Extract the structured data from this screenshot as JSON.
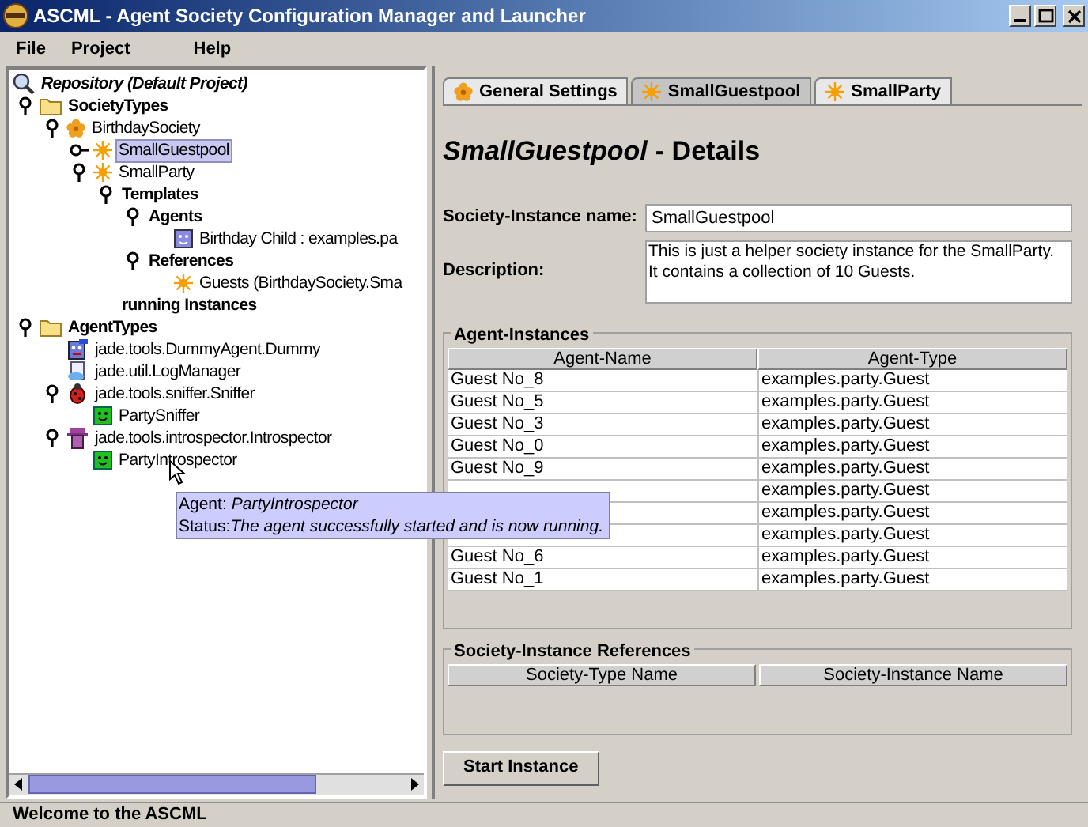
{
  "window": {
    "title": "ASCML - Agent Society Configuration Manager and Launcher"
  },
  "menu": [
    "File",
    "Project",
    "Help"
  ],
  "tree": [
    {
      "label": "Repository (Default Project)",
      "kind": "repository",
      "children": [
        {
          "label": "SocietyTypes",
          "kind": "folder",
          "expanded": true,
          "children": [
            {
              "label": "BirthdaySociety",
              "kind": "society",
              "expanded": true,
              "children": [
                {
                  "label": "SmallGuestpool",
                  "kind": "instance",
                  "expanded": false,
                  "selected": true
                },
                {
                  "label": "SmallParty",
                  "kind": "instance",
                  "expanded": true,
                  "children": [
                    {
                      "label": "Templates",
                      "kind": "category",
                      "expanded": true,
                      "children": [
                        {
                          "label": "Agents",
                          "kind": "category",
                          "expanded": true,
                          "children": [
                            {
                              "label": "Birthday Child : examples.pa",
                              "kind": "agent"
                            }
                          ]
                        },
                        {
                          "label": "References",
                          "kind": "category",
                          "expanded": true,
                          "children": [
                            {
                              "label": "Guests (BirthdaySociety.Sma",
                              "kind": "instance"
                            }
                          ]
                        }
                      ]
                    },
                    {
                      "label": "running Instances",
                      "kind": "category"
                    }
                  ]
                }
              ]
            }
          ]
        },
        {
          "label": "AgentTypes",
          "kind": "folder",
          "expanded": true,
          "children": [
            {
              "label": "jade.tools.DummyAgent.Dummy",
              "kind": "dummy"
            },
            {
              "label": "jade.util.LogManager",
              "kind": "log"
            },
            {
              "label": "jade.tools.sniffer.Sniffer",
              "kind": "sniffer",
              "expanded": true,
              "children": [
                {
                  "label": "PartySniffer",
                  "kind": "running"
                }
              ]
            },
            {
              "label": "jade.tools.introspector.Introspector",
              "kind": "introspector",
              "expanded": true,
              "children": [
                {
                  "label": "PartyIntrospector",
                  "kind": "running"
                }
              ]
            }
          ]
        }
      ]
    }
  ],
  "tooltip": {
    "agent_label": "Agent:",
    "agent": "PartyIntrospector",
    "status_label": "Status:",
    "status": "The agent successfully started and is now running."
  },
  "tabs": [
    {
      "label": "General Settings",
      "kind": "society",
      "selected": false
    },
    {
      "label": "SmallGuestpool",
      "kind": "instance",
      "selected": true
    },
    {
      "label": "SmallParty",
      "kind": "instance",
      "selected": false
    }
  ],
  "heading": {
    "name": "SmallGuestpool",
    "suffix": "- Details"
  },
  "fields": {
    "name_label": "Society-Instance name:",
    "name_value": "SmallGuestpool",
    "description_label": "Description:",
    "description_value": "This is just a helper society instance for the SmallParty.\nIt contains a collection of 10 Guests."
  },
  "agent_instances": {
    "title": "Agent-Instances",
    "columns": [
      "Agent-Name",
      "Agent-Type"
    ],
    "rows": [
      {
        "name": "Guest No_8",
        "type": "examples.party.Guest"
      },
      {
        "name": "Guest No_5",
        "type": "examples.party.Guest"
      },
      {
        "name": "Guest No_3",
        "type": "examples.party.Guest"
      },
      {
        "name": "Guest No_0",
        "type": "examples.party.Guest"
      },
      {
        "name": "Guest No_9",
        "type": "examples.party.Guest"
      },
      {
        "type": "examples.party.Guest"
      },
      {
        "type": "examples.party.Guest"
      },
      {
        "type": "examples.party.Guest"
      },
      {
        "name": "Guest No_6",
        "type": "examples.party.Guest"
      },
      {
        "name": "Guest No_1",
        "type": "examples.party.Guest"
      }
    ]
  },
  "references": {
    "title": "Society-Instance References",
    "columns": [
      "Society-Type Name",
      "Society-Instance Name"
    ]
  },
  "start_button": "Start Instance",
  "status_bar": "Welcome to the ASCML"
}
